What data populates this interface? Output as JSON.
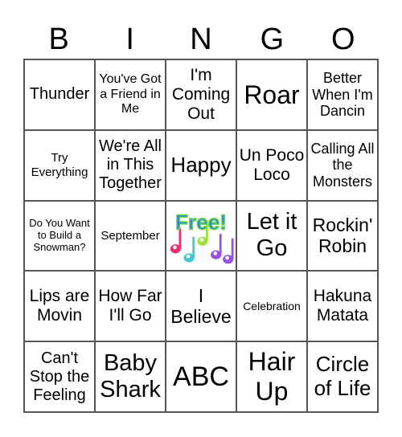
{
  "header": [
    "B",
    "I",
    "N",
    "G",
    "O"
  ],
  "free_label": "Free!",
  "cells": [
    [
      "Thunder",
      "You've Got a Friend in Me",
      "I'm Coming Out",
      "Roar",
      "Better When I'm Dancin"
    ],
    [
      "Try Everything",
      "We're All in This Together",
      "Happy",
      "Un Poco Loco",
      "Calling All the Monsters"
    ],
    [
      "Do You Want to Build a Snowman?",
      "September",
      "Free!",
      "Let it Go",
      "Rockin' Robin"
    ],
    [
      "Lips are Movin",
      "How Far I'll Go",
      "I Believe",
      "Celebration",
      "Hakuna Matata"
    ],
    [
      "Can't Stop the Feeling",
      "Baby Shark",
      "ABC",
      "Hair Up",
      "Circle of Life"
    ]
  ],
  "colors": {
    "free_text": "#2f80e0",
    "free_outline": "#66dd44",
    "notes": [
      "#e8306a",
      "#40c8d8",
      "#a0e040",
      "#9a50e0",
      "#9a50e0"
    ]
  }
}
